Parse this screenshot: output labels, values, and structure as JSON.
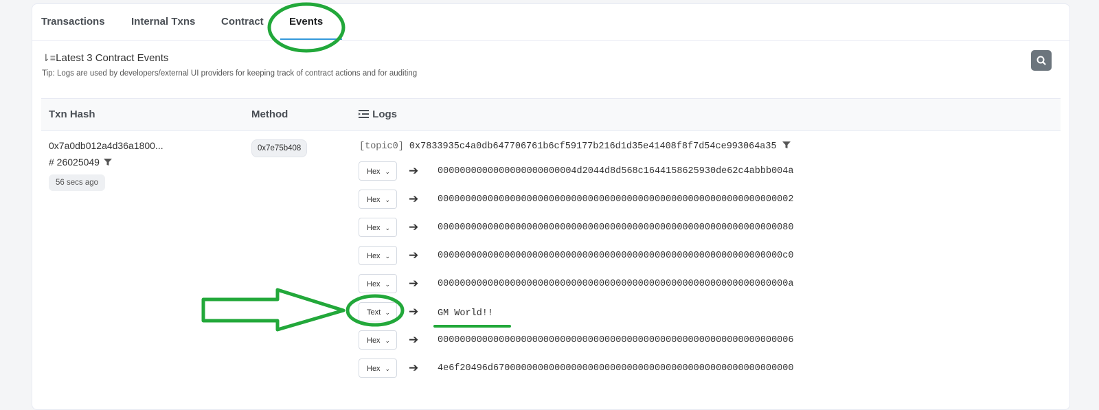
{
  "tabs": [
    "Transactions",
    "Internal Txns",
    "Contract",
    "Events"
  ],
  "events": {
    "title": "Latest 3 Contract Events",
    "tip": "Tip: Logs are used by developers/external UI providers for keeping track of contract actions and for auditing"
  },
  "table": {
    "headers": {
      "txn_hash": "Txn Hash",
      "method": "Method",
      "logs": "Logs"
    },
    "row": {
      "txn_hash": "0x7a0db012a4d36a1800...",
      "block": "# 26025049",
      "age": "56 secs ago",
      "method": "0x7e75b408",
      "topic_label": "[topic0]",
      "topic_value": "0x7833935c4a0db647706761b6cf59177b216d1d35e41408f8f7d54ce993064a35",
      "logs": [
        {
          "format": "Hex",
          "value": "0000000000000000000000004d2044d8d568c1644158625930de62c4abbb004a"
        },
        {
          "format": "Hex",
          "value": "0000000000000000000000000000000000000000000000000000000000000002"
        },
        {
          "format": "Hex",
          "value": "0000000000000000000000000000000000000000000000000000000000000080"
        },
        {
          "format": "Hex",
          "value": "00000000000000000000000000000000000000000000000000000000000000c0"
        },
        {
          "format": "Hex",
          "value": "000000000000000000000000000000000000000000000000000000000000000a"
        },
        {
          "format": "Text",
          "value": "GM World!!"
        },
        {
          "format": "Hex",
          "value": "0000000000000000000000000000000000000000000000000000000000000006"
        },
        {
          "format": "Hex",
          "value": "4e6f20496d670000000000000000000000000000000000000000000000000000"
        }
      ]
    }
  },
  "colors": {
    "annotation": "#22a83a",
    "accent": "#3498db",
    "search_button": "#6c757d"
  },
  "icons": [
    "sort-icon",
    "search-icon",
    "filter-icon",
    "list-icon",
    "arrow-right-icon",
    "chevron-down-icon"
  ]
}
